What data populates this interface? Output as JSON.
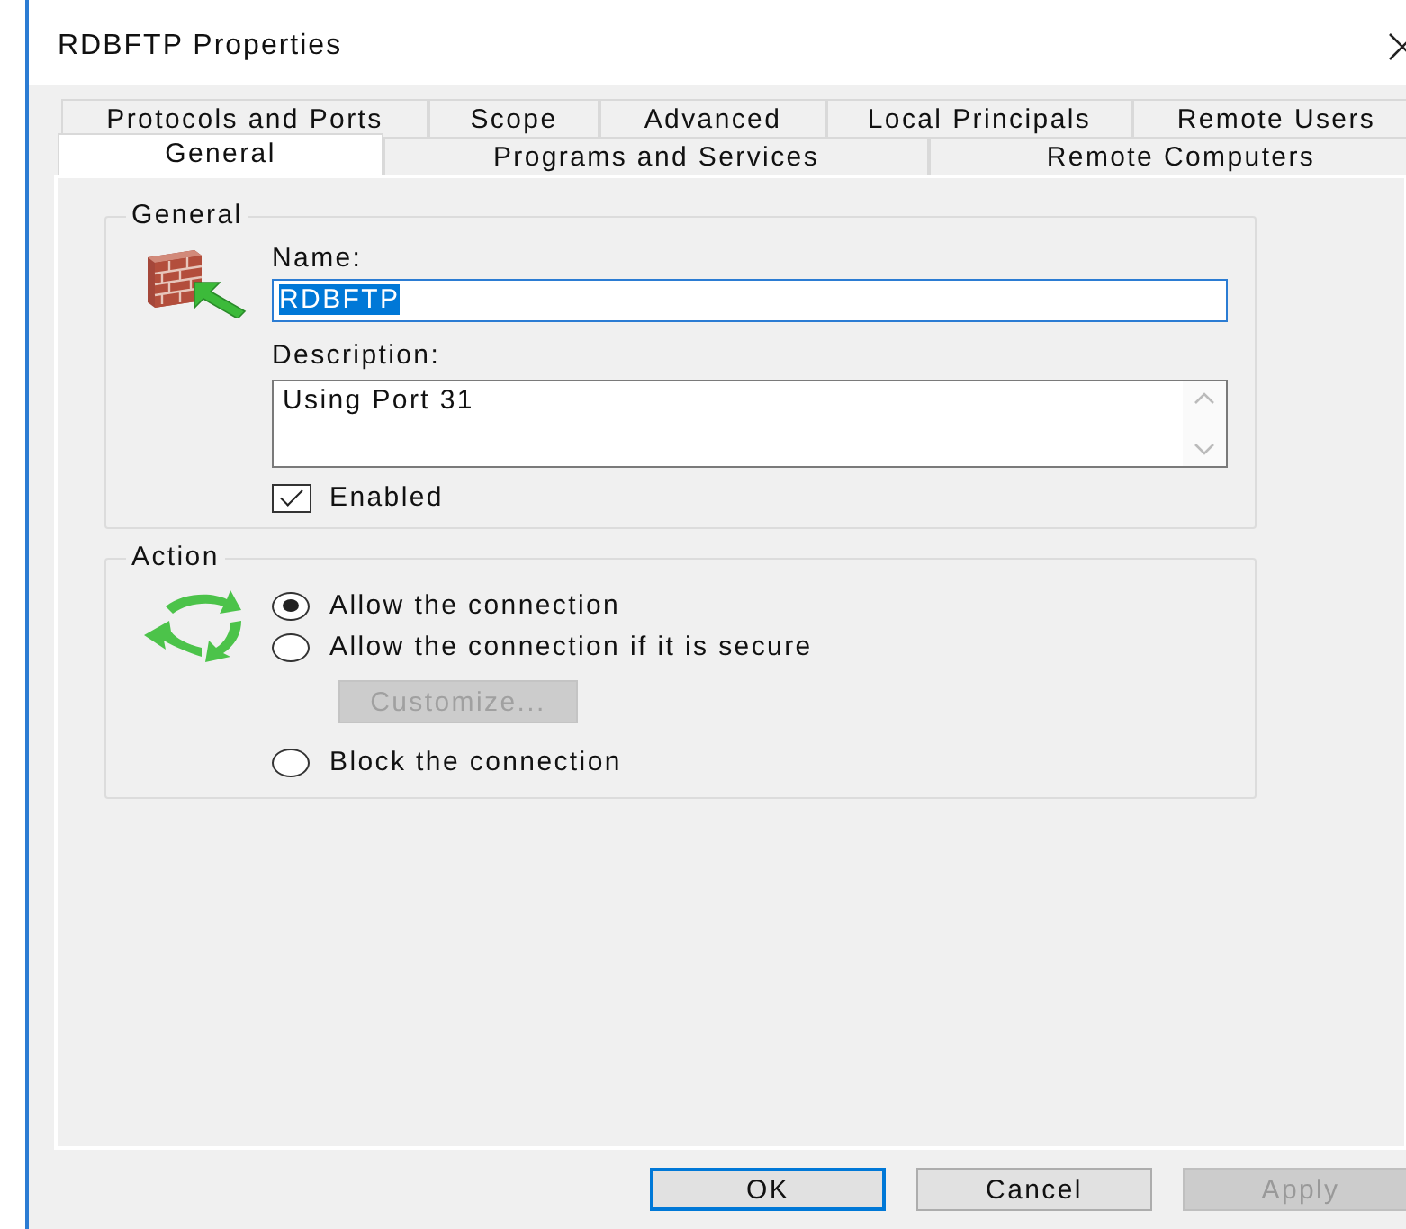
{
  "window": {
    "title": "RDBFTP Properties"
  },
  "tab_rows": [
    {
      "tabs": [
        {
          "label": "Protocols and Ports",
          "selected": false
        },
        {
          "label": "Scope",
          "selected": false
        },
        {
          "label": "Advanced",
          "selected": false
        },
        {
          "label": "Local Principals",
          "selected": false
        },
        {
          "label": "Remote Users",
          "selected": false
        }
      ]
    },
    {
      "tabs": [
        {
          "label": "General",
          "selected": true
        },
        {
          "label": "Programs and Services",
          "selected": false
        },
        {
          "label": "Remote Computers",
          "selected": false
        }
      ]
    }
  ],
  "general": {
    "legend": "General",
    "name_label": "Name:",
    "name_value": "RDBFTP",
    "name_selected": true,
    "description_label": "Description:",
    "description_value": "Using Port 31",
    "enabled": {
      "label": "Enabled",
      "checked": true
    }
  },
  "action": {
    "legend": "Action",
    "items": [
      {
        "kind": "radio",
        "label": "Allow the connection",
        "selected": true
      },
      {
        "kind": "radio",
        "label": "Allow the connection if it is secure",
        "selected": false
      },
      {
        "kind": "button",
        "label": "Customize...",
        "disabled": true
      },
      {
        "kind": "radio",
        "label": "Block the connection",
        "selected": false
      }
    ]
  },
  "buttons": [
    {
      "label": "OK",
      "default": true,
      "disabled": false
    },
    {
      "label": "Cancel",
      "default": false,
      "disabled": false
    },
    {
      "label": "Apply",
      "default": false,
      "disabled": true
    }
  ]
}
